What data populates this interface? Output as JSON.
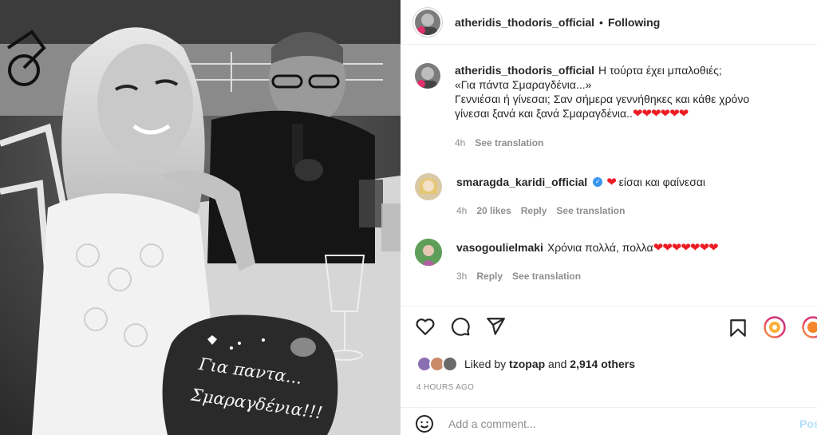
{
  "header": {
    "username": "atheridis_thodoris_official",
    "separator": "•",
    "follow_status": "Following"
  },
  "comments": [
    {
      "username": "atheridis_thodoris_official",
      "lines": [
        "Η τούρτα έχει μπαλοθιές;",
        "«Για πάντα Σμαραγδένια...»",
        "Γεννιέσαι ή γίνεσαι; Σαν σήμερα γεννήθηκες και κάθε χρόνο",
        "γίνεσαι ξανά και ξανά Σμαραγδένια.."
      ],
      "hearts": "❤❤❤❤❤❤",
      "time": "4h",
      "see_translation": "See translation"
    },
    {
      "username": "smaragda_karidi_official",
      "verified_icon": "✓",
      "heart": "❤",
      "text": "είσαι και φαίνεσαι",
      "time": "4h",
      "likes": "20 likes",
      "reply": "Reply",
      "see_translation": "See translation"
    },
    {
      "username": "vasogoulielmaki",
      "text": "Χρόνια πολλά, πολλα",
      "hearts": "❤❤❤❤❤❤❤",
      "time": "3h",
      "reply": "Reply",
      "see_translation": "See translation"
    }
  ],
  "actions": {
    "icons": [
      "heart-outline-icon",
      "comment-icon",
      "share-icon",
      "bookmark-icon"
    ]
  },
  "likes": {
    "prefix": "Liked by",
    "user": "tzopap",
    "and": "and",
    "others": "2,914 others"
  },
  "timestamp": "4 HOURS AGO",
  "add_comment": {
    "placeholder": "Add a comment...",
    "post": "Post"
  },
  "photo": {
    "cake_text_line1": "Για παντα...",
    "cake_text_line2": "Σμαραγδένια!!!"
  },
  "colors": {
    "accent_blue": "#3897f0",
    "post_disabled": "#b2dffc",
    "heart_red": "#ed1c24",
    "muted_text": "#8e8e8e"
  }
}
